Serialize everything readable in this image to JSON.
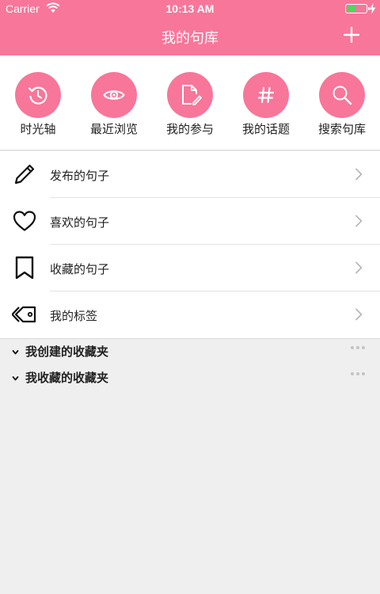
{
  "status_bar": {
    "carrier": "Carrier",
    "time": "10:13 AM",
    "battery_color": "#56d35e"
  },
  "nav": {
    "title": "我的句库",
    "add_icon": "plus-icon"
  },
  "theme": {
    "accent": "#f87699"
  },
  "quick_actions": [
    {
      "label": "时光轴",
      "icon": "history-icon"
    },
    {
      "label": "最近浏览",
      "icon": "eye-icon"
    },
    {
      "label": "我的参与",
      "icon": "document-edit-icon"
    },
    {
      "label": "我的话题",
      "icon": "hashtag-icon"
    },
    {
      "label": "搜索句库",
      "icon": "search-icon"
    }
  ],
  "menu_items": [
    {
      "label": "发布的句子",
      "icon": "pencil-icon"
    },
    {
      "label": "喜欢的句子",
      "icon": "heart-icon"
    },
    {
      "label": "收藏的句子",
      "icon": "bookmark-icon"
    },
    {
      "label": "我的标签",
      "icon": "tag-icon"
    }
  ],
  "folders": [
    {
      "label": "我创建的收藏夹"
    },
    {
      "label": "我收藏的收藏夹"
    }
  ]
}
